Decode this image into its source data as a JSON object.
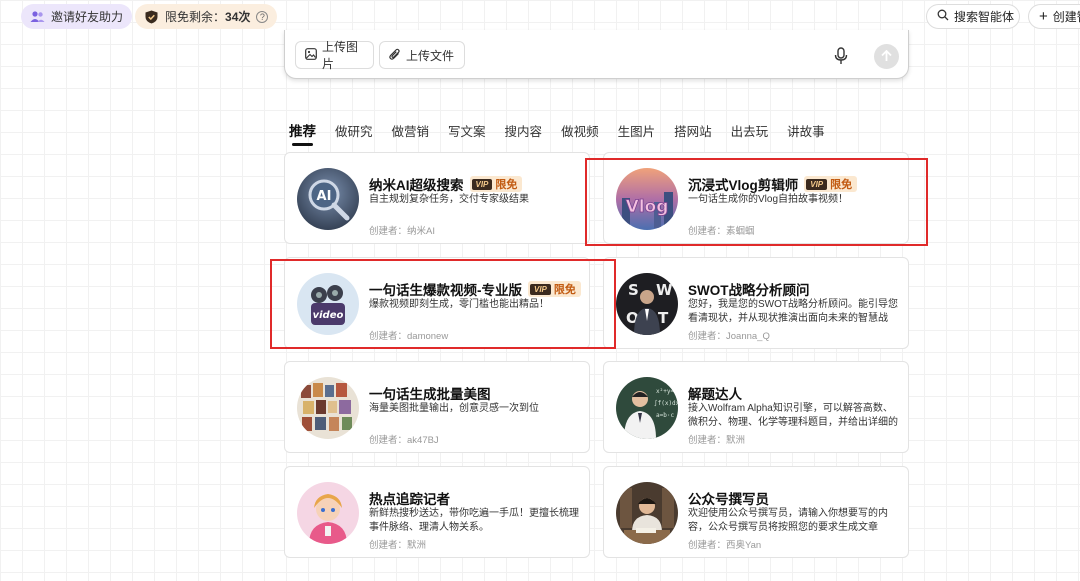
{
  "top": {
    "invite_label": "邀请好友助力",
    "quota_label": "限免剩余：",
    "quota_count": "34次",
    "quota_hint": "?",
    "search_agent_label": "搜索智能体",
    "create_label": "创建智"
  },
  "input": {
    "upload_image_label": "上传图片",
    "upload_file_label": "上传文件"
  },
  "tabs": [
    "推荐",
    "做研究",
    "做营销",
    "写文案",
    "搜内容",
    "做视频",
    "生图片",
    "搭网站",
    "出去玩",
    "讲故事"
  ],
  "cards": [
    {
      "title": "纳米AI超级搜索",
      "badge": "限免",
      "vip": "VIP",
      "desc": "自主规划复杂任务，交付专家级结果",
      "author": "创建者：纳米AI"
    },
    {
      "title": "沉浸式Vlog剪辑师",
      "badge": "限免",
      "vip": "VIP",
      "desc": "一句话生成你的Vlog自拍故事视频！",
      "author": "创建者：素蝈蝈"
    },
    {
      "title": "一句话生爆款视频-专业版",
      "badge": "限免",
      "vip": "VIP",
      "desc": "爆款视频即刻生成，零门槛也能出精品！",
      "author": "创建者：damonew"
    },
    {
      "title": "SWOT战略分析顾问",
      "desc": "您好，我是您的SWOT战略分析顾问。能引导您看清现状，并从现状推演出面向未来的智慧战略。",
      "author": "创建者：Joanna_Q"
    },
    {
      "title": "一句话生成批量美图",
      "desc": "海量美图批量输出，创意灵感一次到位",
      "author": "创建者：ak47BJ"
    },
    {
      "title": "解题达人",
      "desc": "接入Wolfram Alpha知识引擎，可以解答高数、微积分、物理、化学等理科题目，并给出详细的解...",
      "author": "创建者：默洲"
    },
    {
      "title": "热点追踪记者",
      "desc": "新鲜热搜秒送达，带你吃遍一手瓜！更擅长梳理事件脉络、理清人物关系。",
      "author": "创建者：默洲"
    },
    {
      "title": "公众号撰写员",
      "desc": "欢迎使用公众号撰写员，请输入你想要写的内容，公众号撰写员将按照您的要求生成文章",
      "author": "创建者：西奥Yan"
    }
  ],
  "colors": {
    "highlight": "#e02a2a",
    "badge_bg": "#fbe8d0",
    "badge_text": "#c25b12"
  }
}
